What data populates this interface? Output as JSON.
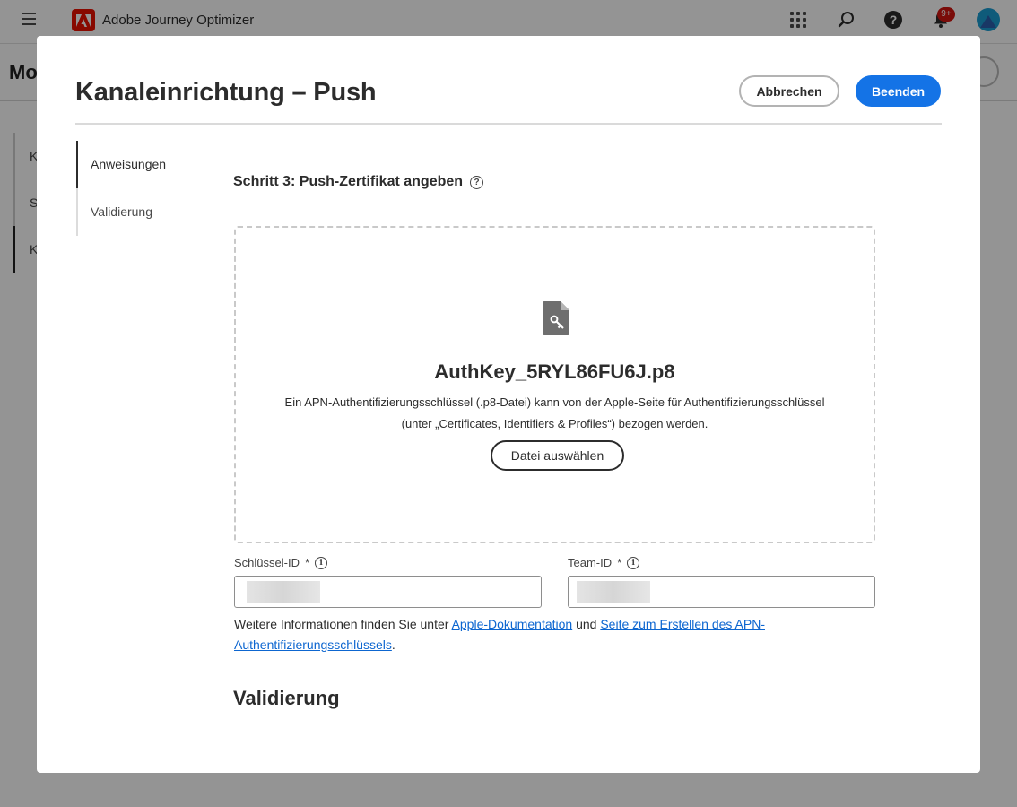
{
  "app": {
    "title": "Adobe Journey Optimizer",
    "notification_count": "9+",
    "background_page_title": "Mo",
    "background_nav": [
      "Ko",
      "SD",
      "Ka"
    ]
  },
  "modal": {
    "title": "Kanaleinrichtung – Push",
    "cancel_label": "Abbrechen",
    "finish_label": "Beenden",
    "nav": [
      {
        "label": "Anweisungen",
        "active": true
      },
      {
        "label": "Validierung",
        "active": false
      }
    ],
    "step_heading": "Schritt 3: Push-Zertifikat angeben",
    "dropzone": {
      "file_name": "AuthKey_5RYL86FU6J.p8",
      "description_line1": "Ein APN-Authentifizierungsschlüssel (.p8-Datei) kann von der Apple-Seite für Authentifizierungsschlüssel",
      "description_line2": "(unter „Certificates, Identifiers & Profiles“) bezogen werden.",
      "choose_label": "Datei auswählen"
    },
    "fields": {
      "key_id_label": "Schlüssel-ID",
      "team_id_label": "Team-ID",
      "required_mark": "*"
    },
    "more_info": {
      "prefix": "Weitere Informationen finden Sie unter ",
      "link1": "Apple-Dokumentation",
      "middle": " und ",
      "link2": "Seite zum Erstellen des APN-Authentifizierungsschlüssels",
      "suffix": "."
    },
    "validation_heading": "Validierung"
  },
  "colors": {
    "accent": "#1473e6",
    "link": "#0d66d0",
    "brand": "#eb1000",
    "badge": "#d31510"
  },
  "icons": [
    "hamburger-icon",
    "adobe-logo-icon",
    "apps-grid-icon",
    "search-icon",
    "help-icon",
    "bell-icon",
    "file-key-icon",
    "help-circle-icon",
    "info-icon"
  ]
}
